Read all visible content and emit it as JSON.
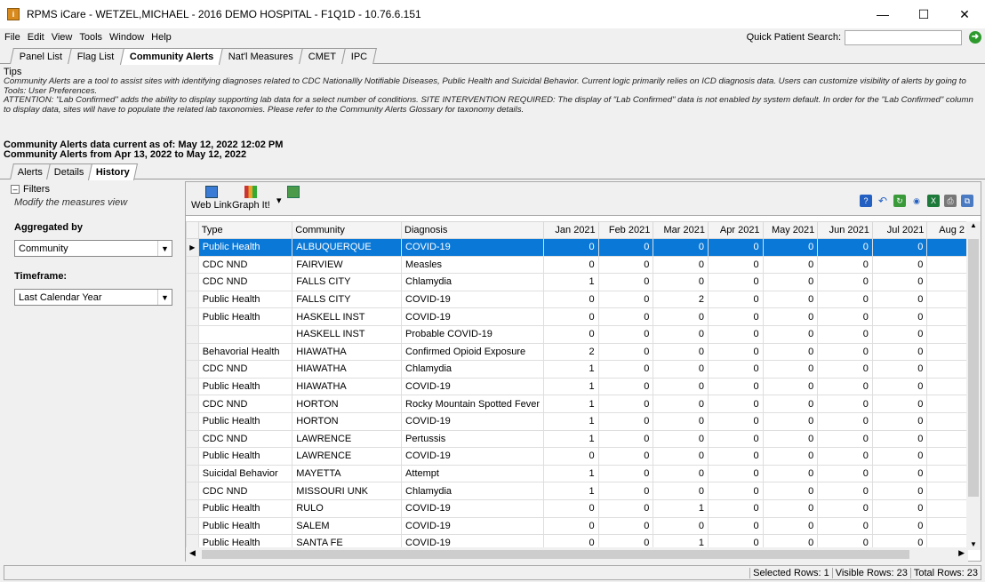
{
  "window": {
    "title": "RPMS iCare - WETZEL,MICHAEL - 2016 DEMO HOSPITAL - F1Q1D - 10.76.6.151",
    "icon": "app-icon"
  },
  "menu": [
    "File",
    "Edit",
    "View",
    "Tools",
    "Window",
    "Help"
  ],
  "quick_search": {
    "label": "Quick Patient Search:",
    "value": ""
  },
  "top_tabs": [
    "Panel List",
    "Flag List",
    "Community Alerts",
    "Nat'l Measures",
    "CMET",
    "IPC"
  ],
  "active_top_tab": "Community Alerts",
  "tips": {
    "title": "Tips",
    "line1": "Community Alerts are a tool to assist sites with identifying diagnoses related to CDC Nationallly Notifiable Diseases, Public Health and Suicidal Behavior.  Current logic primarily relies on ICD diagnosis data.  Users can customize visibility of alerts by going to Tools: User Preferences.",
    "line2": "ATTENTION: \"Lab Confirmed\" adds the ability to display supporting lab data for a select number of conditions.  SITE INTERVENTION REQUIRED: The display of \"Lab Confirmed\" data is not enabled by system default.  In order for the \"Lab Confirmed\" column to display data, sites will have to populate the related lab taxonomies.  Please refer to the Community Alerts Glossary for taxonomy details."
  },
  "info": {
    "current_as_of": "Community Alerts data current as of: May 12, 2022 12:02 PM",
    "range": "Community Alerts from Apr 13, 2022 to May 12, 2022"
  },
  "sub_tabs": [
    "Alerts",
    "Details",
    "History"
  ],
  "active_sub_tab": "History",
  "filters": {
    "header": "Filters",
    "modify": "Modify the measures view",
    "aggregated_label": "Aggregated by",
    "aggregated_value": "Community",
    "timeframe_label": "Timeframe:",
    "timeframe_value": "Last Calendar Year"
  },
  "toolbar": {
    "web_link": "Web Link",
    "graph_it": "Graph It!"
  },
  "grid": {
    "columns": [
      "Type",
      "Community",
      "Diagnosis",
      "Jan 2021",
      "Feb 2021",
      "Mar 2021",
      "Apr 2021",
      "May 2021",
      "Jun 2021",
      "Jul 2021",
      "Aug 2"
    ],
    "rows": [
      {
        "type": "Public Health",
        "community": "ALBUQUERQUE",
        "diagnosis": "COVID-19",
        "v": [
          "0",
          "0",
          "0",
          "0",
          "0",
          "0",
          "0"
        ]
      },
      {
        "type": "CDC NND",
        "community": "FAIRVIEW",
        "diagnosis": "Measles",
        "v": [
          "0",
          "0",
          "0",
          "0",
          "0",
          "0",
          "0"
        ]
      },
      {
        "type": "CDC NND",
        "community": "FALLS CITY",
        "diagnosis": "Chlamydia",
        "v": [
          "1",
          "0",
          "0",
          "0",
          "0",
          "0",
          "0"
        ]
      },
      {
        "type": "Public Health",
        "community": "FALLS CITY",
        "diagnosis": "COVID-19",
        "v": [
          "0",
          "0",
          "2",
          "0",
          "0",
          "0",
          "0"
        ]
      },
      {
        "type": "Public Health",
        "community": "HASKELL INST",
        "diagnosis": "COVID-19",
        "v": [
          "0",
          "0",
          "0",
          "0",
          "0",
          "0",
          "0"
        ]
      },
      {
        "type": "",
        "community": "HASKELL INST",
        "diagnosis": "Probable COVID-19",
        "v": [
          "0",
          "0",
          "0",
          "0",
          "0",
          "0",
          "0"
        ]
      },
      {
        "type": "Behavorial Health",
        "community": "HIAWATHA",
        "diagnosis": "Confirmed Opioid Exposure",
        "v": [
          "2",
          "0",
          "0",
          "0",
          "0",
          "0",
          "0"
        ]
      },
      {
        "type": "CDC NND",
        "community": "HIAWATHA",
        "diagnosis": "Chlamydia",
        "v": [
          "1",
          "0",
          "0",
          "0",
          "0",
          "0",
          "0"
        ]
      },
      {
        "type": "Public Health",
        "community": "HIAWATHA",
        "diagnosis": "COVID-19",
        "v": [
          "1",
          "0",
          "0",
          "0",
          "0",
          "0",
          "0"
        ]
      },
      {
        "type": "CDC NND",
        "community": "HORTON",
        "diagnosis": "Rocky Mountain Spotted Fever",
        "v": [
          "1",
          "0",
          "0",
          "0",
          "0",
          "0",
          "0"
        ]
      },
      {
        "type": "Public Health",
        "community": "HORTON",
        "diagnosis": "COVID-19",
        "v": [
          "1",
          "0",
          "0",
          "0",
          "0",
          "0",
          "0"
        ]
      },
      {
        "type": "CDC NND",
        "community": "LAWRENCE",
        "diagnosis": "Pertussis",
        "v": [
          "1",
          "0",
          "0",
          "0",
          "0",
          "0",
          "0"
        ]
      },
      {
        "type": "Public Health",
        "community": "LAWRENCE",
        "diagnosis": "COVID-19",
        "v": [
          "0",
          "0",
          "0",
          "0",
          "0",
          "0",
          "0"
        ]
      },
      {
        "type": "Suicidal Behavior",
        "community": "MAYETTA",
        "diagnosis": "Attempt",
        "v": [
          "1",
          "0",
          "0",
          "0",
          "0",
          "0",
          "0"
        ]
      },
      {
        "type": "CDC NND",
        "community": "MISSOURI UNK",
        "diagnosis": "Chlamydia",
        "v": [
          "1",
          "0",
          "0",
          "0",
          "0",
          "0",
          "0"
        ]
      },
      {
        "type": "Public Health",
        "community": "RULO",
        "diagnosis": "COVID-19",
        "v": [
          "0",
          "0",
          "1",
          "0",
          "0",
          "0",
          "0"
        ]
      },
      {
        "type": "Public Health",
        "community": "SALEM",
        "diagnosis": "COVID-19",
        "v": [
          "0",
          "0",
          "0",
          "0",
          "0",
          "0",
          "0"
        ]
      },
      {
        "type": "Public Health",
        "community": "SANTA FE",
        "diagnosis": "COVID-19",
        "v": [
          "0",
          "0",
          "1",
          "0",
          "0",
          "0",
          "0"
        ]
      }
    ]
  },
  "status": {
    "selected": "Selected Rows: 1",
    "visible": "Visible Rows: 23",
    "total": "Total Rows: 23"
  },
  "colors": {
    "selection": "#0a78d6",
    "go_icon": "#2e9a2e"
  }
}
